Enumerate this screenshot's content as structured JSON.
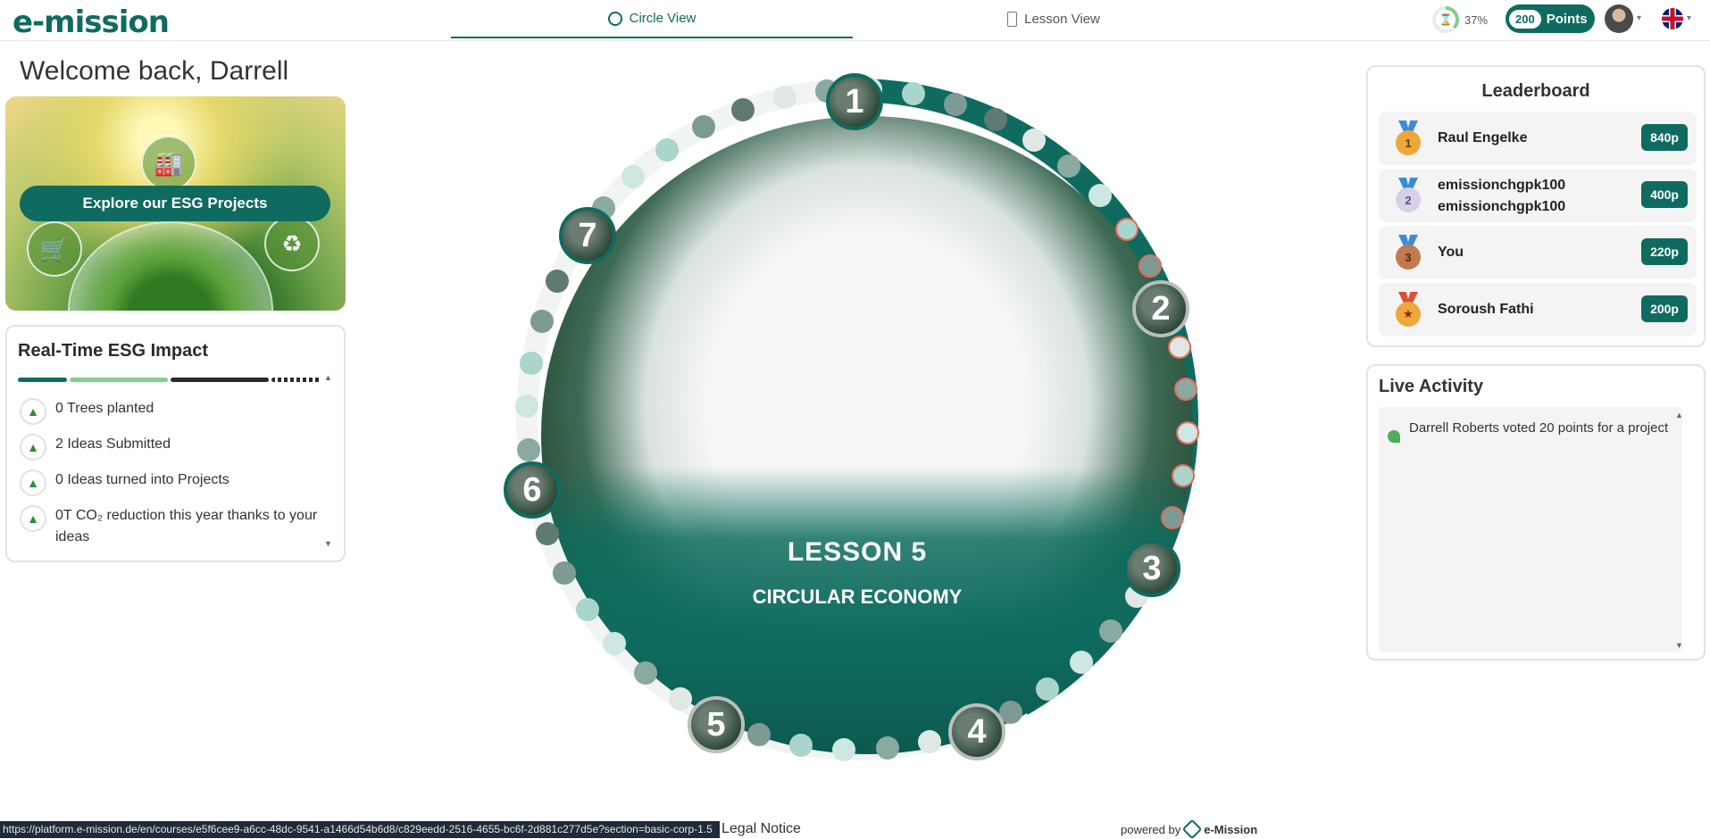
{
  "brand": {
    "logo": "e-mission"
  },
  "tabs": [
    {
      "label": "Circle View",
      "active": true
    },
    {
      "label": "Lesson View",
      "active": false
    }
  ],
  "header": {
    "progress": "37%",
    "points_value": "200",
    "points_label": "Points"
  },
  "welcome": "Welcome back, Darrell",
  "esg_banner": {
    "button_label": "Explore our ESG Projects"
  },
  "impact": {
    "title": "Real-Time ESG Impact",
    "items": [
      {
        "text": "0 Trees planted"
      },
      {
        "text": "2 Ideas Submitted"
      },
      {
        "text": "0 Ideas turned into Projects"
      },
      {
        "text": "0T CO₂ reduction this year thanks to your ideas"
      }
    ]
  },
  "circle": {
    "lesson_label": "LESSON 5",
    "lesson_name": "CIRCULAR ECONOMY",
    "nodes": [
      "1",
      "2",
      "3",
      "4",
      "5",
      "6",
      "7"
    ]
  },
  "leaderboard": {
    "title": "Leaderboard",
    "rows": [
      {
        "rank": "1",
        "name": "Raul Engelke",
        "points": "840p"
      },
      {
        "rank": "2",
        "name": "emissionchgpk100 emissionchgpk100",
        "points": "400p"
      },
      {
        "rank": "3",
        "name": "You",
        "points": "220p"
      },
      {
        "rank": "★",
        "name": "Soroush Fathi",
        "points": "200p"
      }
    ]
  },
  "live_activity": {
    "title": "Live Activity",
    "items": [
      {
        "text": "Darrell Roberts voted 20 points for a project"
      }
    ]
  },
  "footer": {
    "status_url": "https://platform.e-mission.de/en/courses/e5f6cee9-a6cc-48dc-9541-a1466d54b6d8/c829eedd-2516-4655-bc6f-2d881c277d5e?section=basic-corp-1.5",
    "legal": "Legal Notice",
    "powered_by": "powered by",
    "powered_brand": "e-Mission"
  },
  "colors": {
    "brand": "#0f6b5f",
    "accent": "#7fcf8e"
  }
}
